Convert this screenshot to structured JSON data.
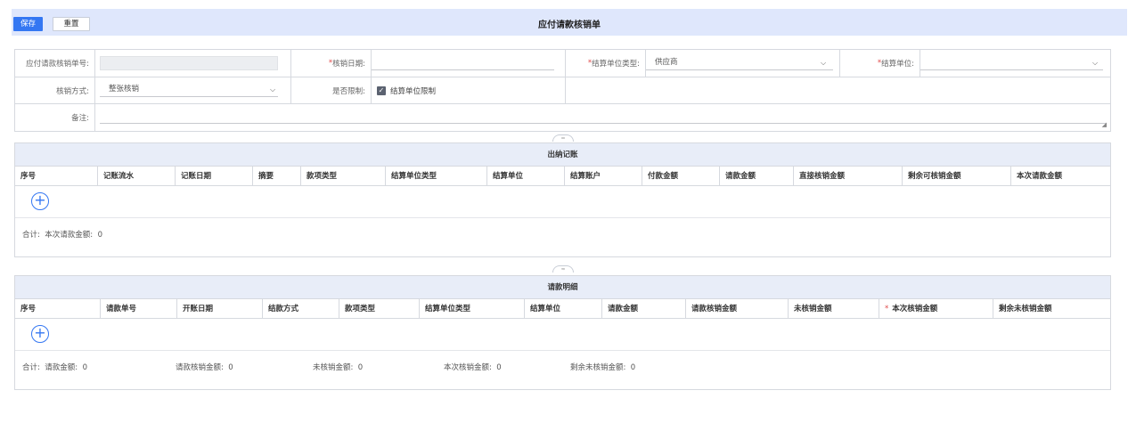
{
  "toolbar": {
    "save_label": "保存",
    "reset_label": "重置",
    "title": "应付请款核销单"
  },
  "form": {
    "bill_no": {
      "label": "应付请款核销单号:",
      "value": ""
    },
    "date": {
      "label": "核销日期:",
      "required": "*",
      "value": ""
    },
    "unit_type": {
      "label": "结算单位类型:",
      "required": "*",
      "value": "供应商"
    },
    "unit": {
      "label": "结算单位:",
      "required": "*",
      "value": ""
    },
    "method": {
      "label": "核销方式:",
      "value": "整张核销"
    },
    "limit": {
      "label": "是否限制:",
      "checkbox_label": "结算单位限制",
      "checked": true
    },
    "remark": {
      "label": "备注:",
      "value": ""
    }
  },
  "handles": {
    "glyph1": "=",
    "glyph2": "≈"
  },
  "cash_panel": {
    "title": "出纳记账",
    "columns": [
      "序号",
      "记账流水",
      "记账日期",
      "摘要",
      "款项类型",
      "结算单位类型",
      "结算单位",
      "结算账户",
      "付款金额",
      "请款金额",
      "直接核销金额",
      "剩余可核销金额",
      "本次请款金额"
    ],
    "add_symbol": "+",
    "totals": {
      "prefix": "合计:",
      "items": [
        {
          "label": "本次请款金额:",
          "value": "0"
        }
      ]
    }
  },
  "detail_panel": {
    "title": "请款明细",
    "columns": [
      "序号",
      "请款单号",
      "开账日期",
      "结款方式",
      "款项类型",
      "结算单位类型",
      "结算单位",
      "请款金额",
      "请款核销金额",
      "未核销金额",
      "本次核销金额",
      "剩余未核销金额"
    ],
    "required_mark": "*",
    "add_symbol": "+",
    "totals": {
      "prefix": "合计:",
      "items": [
        {
          "label": "请款金额:",
          "value": "0"
        },
        {
          "label": "请款核销金额:",
          "value": "0"
        },
        {
          "label": "未核销金额:",
          "value": "0"
        },
        {
          "label": "本次核销金额:",
          "value": "0"
        },
        {
          "label": "剩余未核销金额:",
          "value": "0"
        }
      ]
    }
  },
  "icons": {
    "chevron": "chevron-down-icon",
    "checkbox": "check-icon",
    "plus": "plus-circle-icon",
    "resize": "resize-grip-icon"
  }
}
